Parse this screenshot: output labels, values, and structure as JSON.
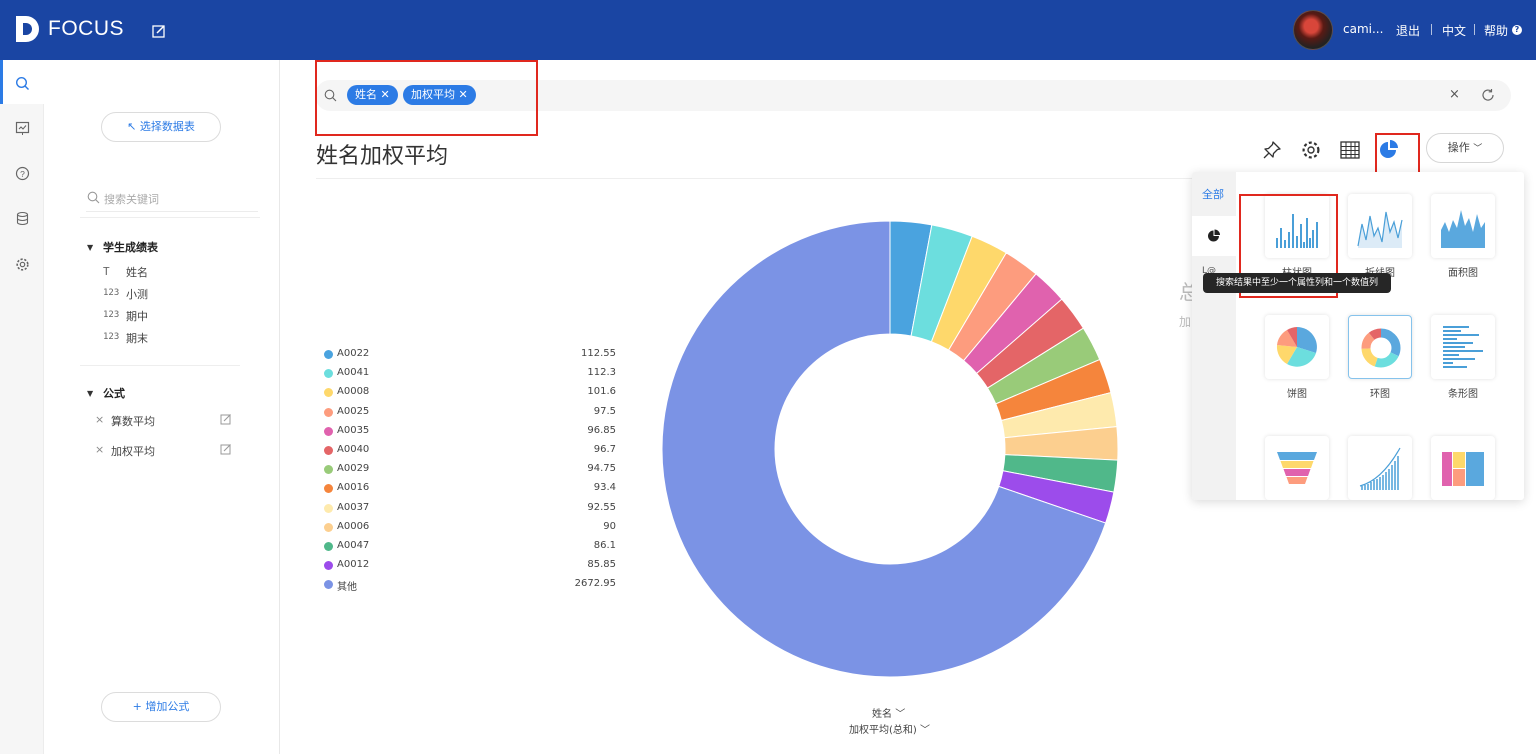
{
  "app": {
    "logo_text": "FOCUS"
  },
  "header": {
    "username": "cami...",
    "logout": "退出",
    "language": "中文",
    "help": "帮助"
  },
  "sidebar": {
    "select_table_button": "↖ 选择数据表",
    "search_placeholder": "搜索关键词",
    "table_name": "学生成绩表",
    "columns": [
      {
        "type_icon": "T",
        "label": "姓名"
      },
      {
        "type_icon": "123",
        "label": "小测"
      },
      {
        "type_icon": "123",
        "label": "期中"
      },
      {
        "type_icon": "123",
        "label": "期末"
      }
    ],
    "formula_header": "公式",
    "formulas": [
      {
        "label": "算数平均"
      },
      {
        "label": "加权平均"
      }
    ],
    "add_formula_button": "+ 增加公式"
  },
  "search": {
    "chips": [
      "姓名",
      "加权平均"
    ]
  },
  "page": {
    "title": "姓名加权平均",
    "operation_button": "操作"
  },
  "chart_data": {
    "type": "pie",
    "subtype": "donut",
    "categories": [
      "A0022",
      "A0041",
      "A0008",
      "A0025",
      "A0035",
      "A0040",
      "A0029",
      "A0016",
      "A0037",
      "A0006",
      "A0047",
      "A0012",
      "其他"
    ],
    "values": [
      112.55,
      112.3,
      101.6,
      97.5,
      96.85,
      96.7,
      94.75,
      93.4,
      92.55,
      90,
      86.1,
      85.85,
      2672.95
    ],
    "value_labels": [
      "112.55",
      "112.3",
      "101.6",
      "97.5",
      "96.85",
      "96.7",
      "94.75",
      "93.4",
      "92.55",
      "90",
      "86.1",
      "85.85",
      "2672.95"
    ],
    "colors": [
      "#4aa3df",
      "#6cdede",
      "#fed86b",
      "#fd9c7e",
      "#e062ae",
      "#e46567",
      "#99cb79",
      "#f5853c",
      "#feeaad",
      "#fccf8f",
      "#50b88a",
      "#9c4ceb",
      "#7b93e5"
    ],
    "legend_position": "left",
    "x_selector": "姓名",
    "y_selector": "加权平均(总和)"
  },
  "background_text": {
    "big": "总",
    "small": "加"
  },
  "chart_picker": {
    "all_tab": "全部",
    "charts": [
      {
        "id": "bar",
        "label": "柱状图",
        "selected": false
      },
      {
        "id": "line",
        "label": "折线图",
        "selected": false
      },
      {
        "id": "area",
        "label": "面积图",
        "selected": false
      },
      {
        "id": "pie",
        "label": "饼图",
        "selected": false
      },
      {
        "id": "donut",
        "label": "环图",
        "selected": true
      },
      {
        "id": "horizontal-bar",
        "label": "条形图",
        "selected": false
      },
      {
        "id": "funnel",
        "label": "",
        "selected": false
      },
      {
        "id": "cumulative",
        "label": "",
        "selected": false
      },
      {
        "id": "treemap",
        "label": "",
        "selected": false
      }
    ],
    "tooltip": "搜索结果中至少一个属性列和一个数值列"
  },
  "colors": {
    "header_bg": "#1a45a3",
    "accent": "#2c7be5",
    "highlight_red": "#e0281e"
  }
}
